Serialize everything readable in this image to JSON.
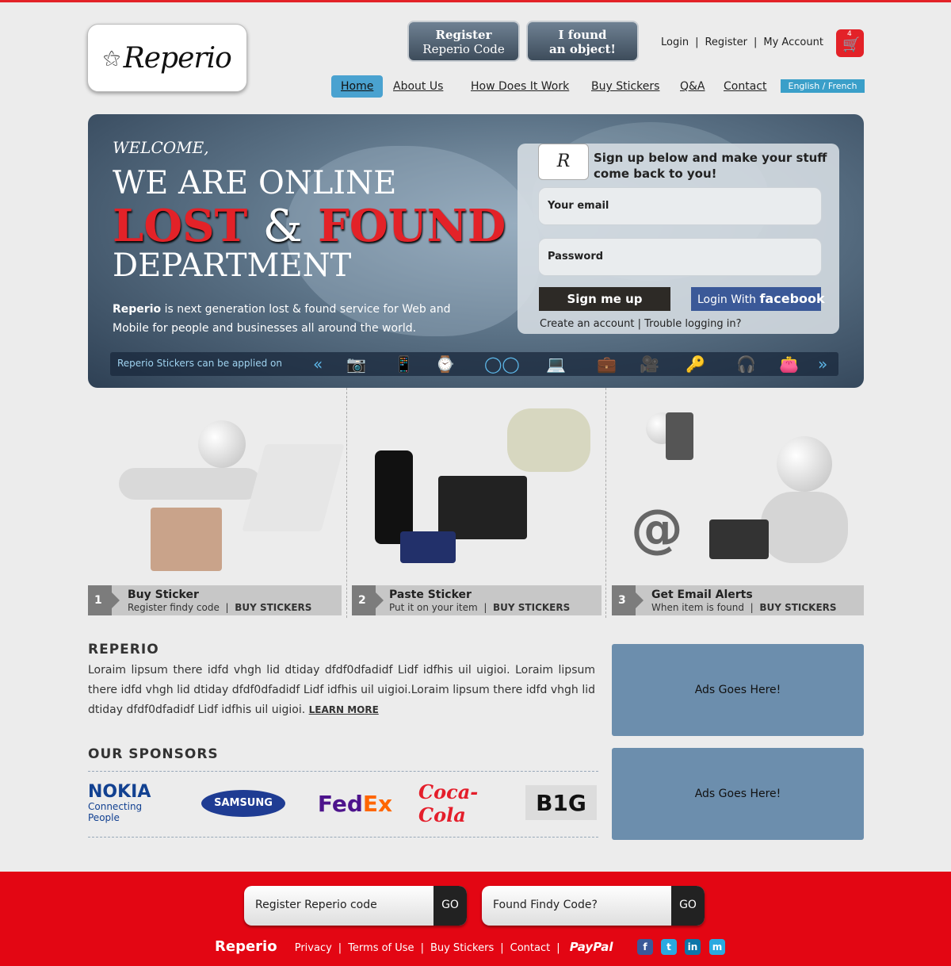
{
  "header": {
    "logo_text": "Reperio",
    "btn_register": {
      "line1": "Register",
      "line2": "Reperio Code"
    },
    "btn_found": {
      "line1": "I found",
      "line2": "an object!"
    },
    "toplinks": {
      "login": "Login",
      "register": "Register",
      "account": "My Account",
      "sep": "|"
    },
    "cart_count": "4",
    "nav": {
      "home": "Home",
      "about": "About Us",
      "how": "How Does It Work",
      "buy": "Buy Stickers",
      "qa": "Q&A",
      "contact": "Contact"
    },
    "lang": "English / French"
  },
  "hero": {
    "welcome": "WELCOME,",
    "line1": "WE ARE ONLINE",
    "lost": "LOST",
    "amp": "&",
    "found": "FOUND",
    "line3": "DEPARTMENT",
    "desc_brand": "Reperio",
    "desc_rest": " is next generation lost & found service for Web and Mobile for people and businesses all around the world.",
    "signup_title": "Sign up below and make your stuff come back to you!",
    "email_placeholder": "Your email",
    "password_placeholder": "Password",
    "signup_btn": "Sign me up",
    "fb_prefix": "Login With ",
    "fb_brand": "facebook",
    "create_account": "Create an account",
    "link_sep": "|",
    "trouble": "Trouble logging in?",
    "apply_text": "Reperio Stickers can be applied on",
    "icons": [
      "camera-icon",
      "phone-icon",
      "watch-icon",
      "glasses-icon",
      "laptop-icon",
      "bag-icon",
      "video-camera-icon",
      "key-icon",
      "headphones-icon",
      "wallet-icon"
    ]
  },
  "steps": [
    {
      "num": "1",
      "title": "Buy Sticker",
      "sub": "Register findy code",
      "sep": "|",
      "link": "BUY STICKERS"
    },
    {
      "num": "2",
      "title": "Paste Sticker",
      "sub": "Put it on your item",
      "sep": "|",
      "link": "BUY STICKERS"
    },
    {
      "num": "3",
      "title": "Get Email Alerts",
      "sub": "When item is found",
      "sep": "|",
      "link": "BUY STICKERS"
    }
  ],
  "about": {
    "title": "REPERIO",
    "text": "Loraim lipsum there idfd vhgh lid dtiday dfdf0dfadidf  Lidf idfhis uil uigioi. Loraim lipsum there idfd vhgh lid dtiday dfdf0dfadidf  Lidf idfhis uil uigioi.Loraim lipsum there idfd vhgh lid dtiday dfdf0dfadidf  Lidf idfhis uil uigioi. ",
    "learn_more": "LEARN MORE"
  },
  "sponsors": {
    "title": "OUR  SPONSORS",
    "nokia": "NOKIA",
    "nokia_tag": "Connecting People",
    "samsung": "SAMSUNG",
    "fedex_fe": "Fed",
    "fedex_ex": "Ex",
    "coke": "Coca-Cola",
    "big": "B1G"
  },
  "ads": [
    "Ads Goes Here!",
    "Ads Goes Here!"
  ],
  "footer": {
    "register_field": "Register Reperio code",
    "found_field": "Found Findy Code?",
    "go": "GO",
    "brand": "Reperio",
    "privacy": "Privacy",
    "terms": "Terms of Use",
    "buy": "Buy Stickers",
    "contact": "Contact",
    "sep": "|",
    "paypal": "PayPal",
    "social": [
      {
        "name": "facebook-icon",
        "glyph": "f",
        "color": "#3b5998"
      },
      {
        "name": "twitter-icon",
        "glyph": "t",
        "color": "#2aa9e0"
      },
      {
        "name": "linkedin-icon",
        "glyph": "in",
        "color": "#0e76a8"
      },
      {
        "name": "myspace-icon",
        "glyph": "m",
        "color": "#2aa9e0"
      }
    ]
  },
  "colors": {
    "brand_red": "#e32228",
    "accent_blue": "#3a9fc9",
    "ad_blue": "#6c8ead",
    "facebook_blue": "#3b5998"
  }
}
